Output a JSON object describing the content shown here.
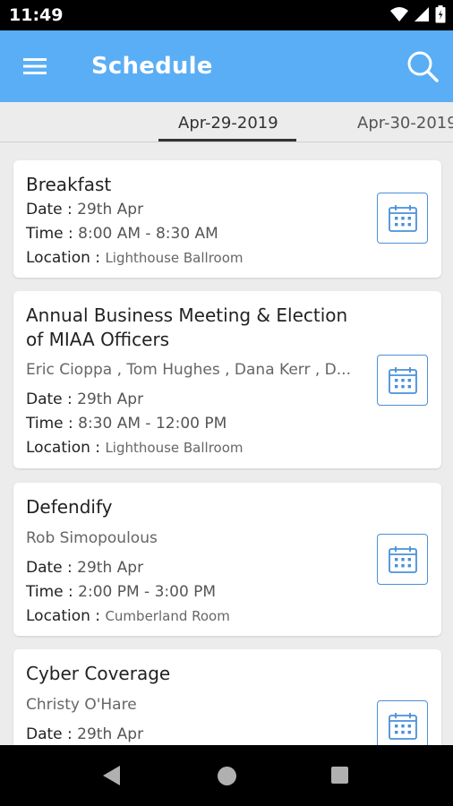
{
  "status_bar": {
    "time": "11:49"
  },
  "app_bar": {
    "title": "Schedule"
  },
  "tabs": [
    {
      "label": "Apr-29-2019",
      "selected": true
    },
    {
      "label": "Apr-30-2019",
      "selected": false
    }
  ],
  "labels": {
    "date": "Date :",
    "time": "Time :",
    "location": "Location :"
  },
  "sessions": [
    {
      "title": "Breakfast",
      "date": "29th Apr",
      "time": "8:00 AM - 8:30 AM",
      "location": "Lighthouse Ballroom"
    },
    {
      "title": "Annual Business Meeting & Election of MIAA Officers",
      "speakers": "Eric Cioppa , Tom Hughes , Dana Kerr , D...",
      "date": "29th Apr",
      "time": "8:30 AM - 12:00 PM",
      "location": "Lighthouse Ballroom"
    },
    {
      "title": "Defendify",
      "speakers": "Rob Simopoulous",
      "date": "29th Apr",
      "time": "2:00 PM - 3:00 PM",
      "location": "Cumberland Room"
    },
    {
      "title": "Cyber Coverage",
      "speakers": "Christy O'Hare",
      "date": "29th Apr"
    }
  ],
  "colors": {
    "app_bar": "#5aaef5",
    "accent": "#4a90d9",
    "background": "#ececec"
  },
  "icons": [
    "wifi-icon",
    "signal-icon",
    "battery-icon",
    "menu-icon",
    "search-icon",
    "calendar-icon",
    "back-icon",
    "home-icon",
    "recents-icon"
  ]
}
